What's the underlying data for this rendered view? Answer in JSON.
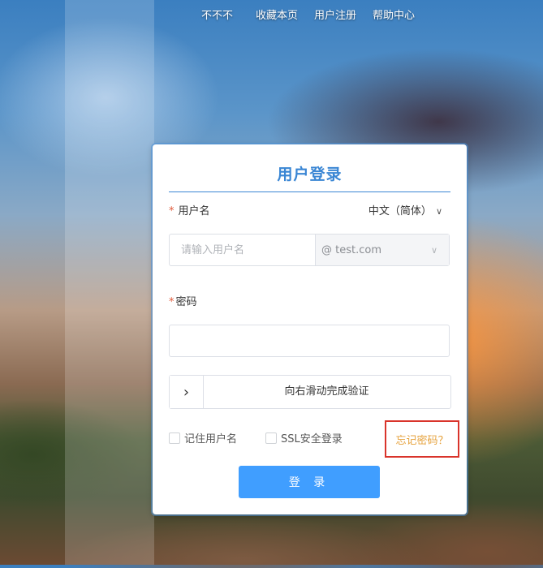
{
  "nav": {
    "item1": "不不不",
    "item2": "收藏本页",
    "item3": "用户注册",
    "item4": "帮助中心"
  },
  "login": {
    "title": "用户登录",
    "username_label": "用户名",
    "required_mark": "*",
    "language": "中文（简体）",
    "username_placeholder": "请输入用户名",
    "domain": "@ test.com",
    "password_label": "密码",
    "slider_text": "向右滑动完成验证",
    "remember_label": "记住用户名",
    "ssl_label": "SSL安全登录",
    "forgot_label": "忘记密码？",
    "submit_label": "登 录"
  },
  "colors": {
    "accent": "#3a86d4",
    "button": "#409eff",
    "forgot_text": "#e6a23c",
    "highlight_border": "#d9342b"
  }
}
